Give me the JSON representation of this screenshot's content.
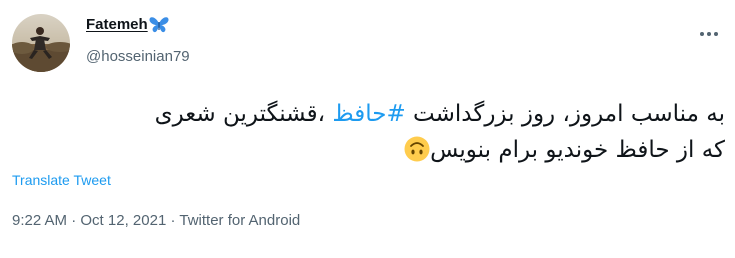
{
  "author": {
    "display_name": "Fatemeh",
    "handle": "@hosseinian79"
  },
  "tweet": {
    "line1_pre": "به مناسب امروز، روز بزرگداشت ",
    "hashtag": "#حافظ",
    "line1_post": " ،قشنگترین شعری",
    "line2": "که از حافظ خوندیو برام بنویس",
    "emoji": "upside-down-face-emoji"
  },
  "translate_label": "Translate Tweet",
  "meta": {
    "time": "9:22 AM",
    "sep1": " · ",
    "date": "Oct 12, 2021",
    "sep2": " · ",
    "source": "Twitter for Android"
  },
  "icons": {
    "verified_like": "butterfly-icon",
    "more": "more-options-icon"
  },
  "colors": {
    "link": "#1d9bf0",
    "secondary": "#536471",
    "text": "#0f1419",
    "butterfly": "#3b8ee6",
    "emoji": "#ffcc4d"
  }
}
